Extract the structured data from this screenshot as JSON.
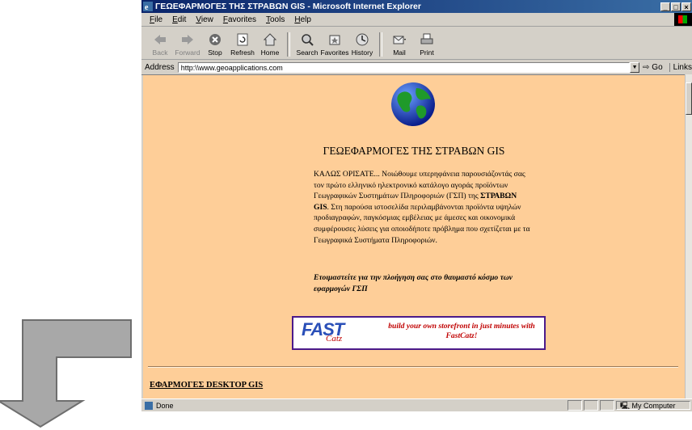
{
  "window": {
    "title": "ΓΕΩΕΦΑΡΜΟΓΕΣ ΤΗΣ ΣΤΡΑΒΩΝ GIS - Microsoft Internet Explorer"
  },
  "menu": [
    "File",
    "Edit",
    "View",
    "Favorites",
    "Tools",
    "Help"
  ],
  "toolbar": {
    "back": "Back",
    "forward": "Forward",
    "stop": "Stop",
    "refresh": "Refresh",
    "home": "Home",
    "search": "Search",
    "favorites": "Favorites",
    "history": "History",
    "mail": "Mail",
    "print": "Print"
  },
  "address": {
    "label": "Address",
    "value": "http:\\\\www.geoapplications.com",
    "go": "Go",
    "links": "Links"
  },
  "page": {
    "title": "ΓΕΩΕΦΑΡΜΟΓΕΣ ΤΗΣ ΣΤΡΑΒΩΝ GIS",
    "intro_part1": "ΚΑΛΩΣ ΟΡΙΣΑΤΕ... Νοιώθουμε υπερηφάνεια παρουσιάζοντάς σας τον πρώτο ελληνικό ηλεκτρονικό κατάλογο αγοράς προϊόντων Γεωγραφικών Συστημάτων Πληροφοριών (ΓΣΠ) της ",
    "intro_bold": "ΣΤΡΑΒΩΝ GIS",
    "intro_part2": ". Στη παρούσα ιστοσελίδα περιλαμβάνονται προϊόντα υψηλών προδιαγραφών, παγκόσμιας εμβέλειας με άμεσες και οικονομικά συμφέρουσες λύσεις για οποιοδήποτε πρόβλημα που σχετίζεται με τα Γεωγραφικά Συστήματα Πληροφοριών.",
    "cta": "Ετοιμαστείτε για την πλοήγηση σας στο θαυμαστό κόσμο των εφαρμογών ΓΣΠ",
    "banner_logo": "FAST",
    "banner_logo_sub": "Catz",
    "banner_tag": "build your own storefront in just minutes with FastCatz!",
    "section_link": "ΕΦΑΡΜΟΓΕΣ DESKTOP GIS"
  },
  "status": {
    "text": "Done",
    "zone": "My Computer"
  },
  "colors": {
    "page_bg": "#fece98",
    "titlebar": "#0a246a",
    "banner_border": "#4b1a8a",
    "banner_text": "#c00000"
  }
}
